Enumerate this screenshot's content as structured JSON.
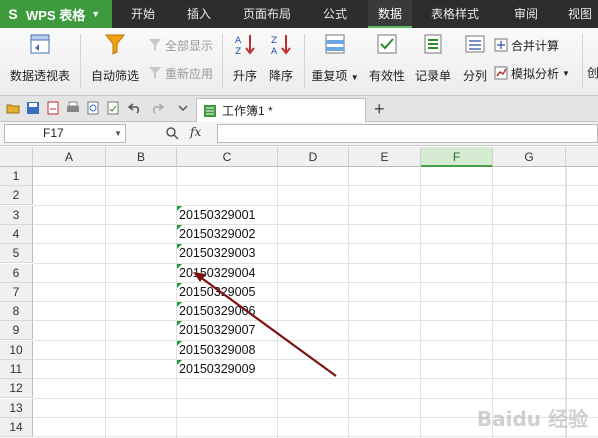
{
  "app": {
    "name": "WPS 表格"
  },
  "menu": [
    "开始",
    "插入",
    "页面布局",
    "公式",
    "数据",
    "表格样式",
    "审阅",
    "视图"
  ],
  "active_menu": "数据",
  "ribbon": {
    "pivot": "数据透视表",
    "autofilter": "自动筛选",
    "show_all": "全部显示",
    "reapply": "重新应用",
    "sort_asc": "升序",
    "sort_desc": "降序",
    "duplicates": "重复项",
    "validity": "有效性",
    "record_form": "记录单",
    "split": "分列",
    "merge_calc": "合并计算",
    "what_if": "模拟分析",
    "more": "创"
  },
  "doc_tab": {
    "title": "工作簿1 *"
  },
  "formula_bar": {
    "name_box": "F17",
    "fx": "fx",
    "value": ""
  },
  "columns": [
    "A",
    "B",
    "C",
    "D",
    "E",
    "F",
    "G"
  ],
  "selected_column": "F",
  "rows": [
    "1",
    "2",
    "3",
    "4",
    "5",
    "6",
    "7",
    "8",
    "9",
    "10",
    "11",
    "12",
    "13",
    "14"
  ],
  "cells": [
    {
      "ref": "C3",
      "value": "20150329001"
    },
    {
      "ref": "C4",
      "value": "20150329002"
    },
    {
      "ref": "C5",
      "value": "20150329003"
    },
    {
      "ref": "C6",
      "value": "20150329004"
    },
    {
      "ref": "C7",
      "value": "20150329005"
    },
    {
      "ref": "C8",
      "value": "20150329006"
    },
    {
      "ref": "C9",
      "value": "20150329007"
    },
    {
      "ref": "C10",
      "value": "20150329008"
    },
    {
      "ref": "C11",
      "value": "20150329009"
    }
  ],
  "watermark": "Baidu 经验",
  "colors": {
    "accent_green": "#3d9b3d",
    "menubar": "#2d2d2d",
    "text_flag": "#1e9b3a",
    "annotation_arrow": "#7a1414"
  }
}
